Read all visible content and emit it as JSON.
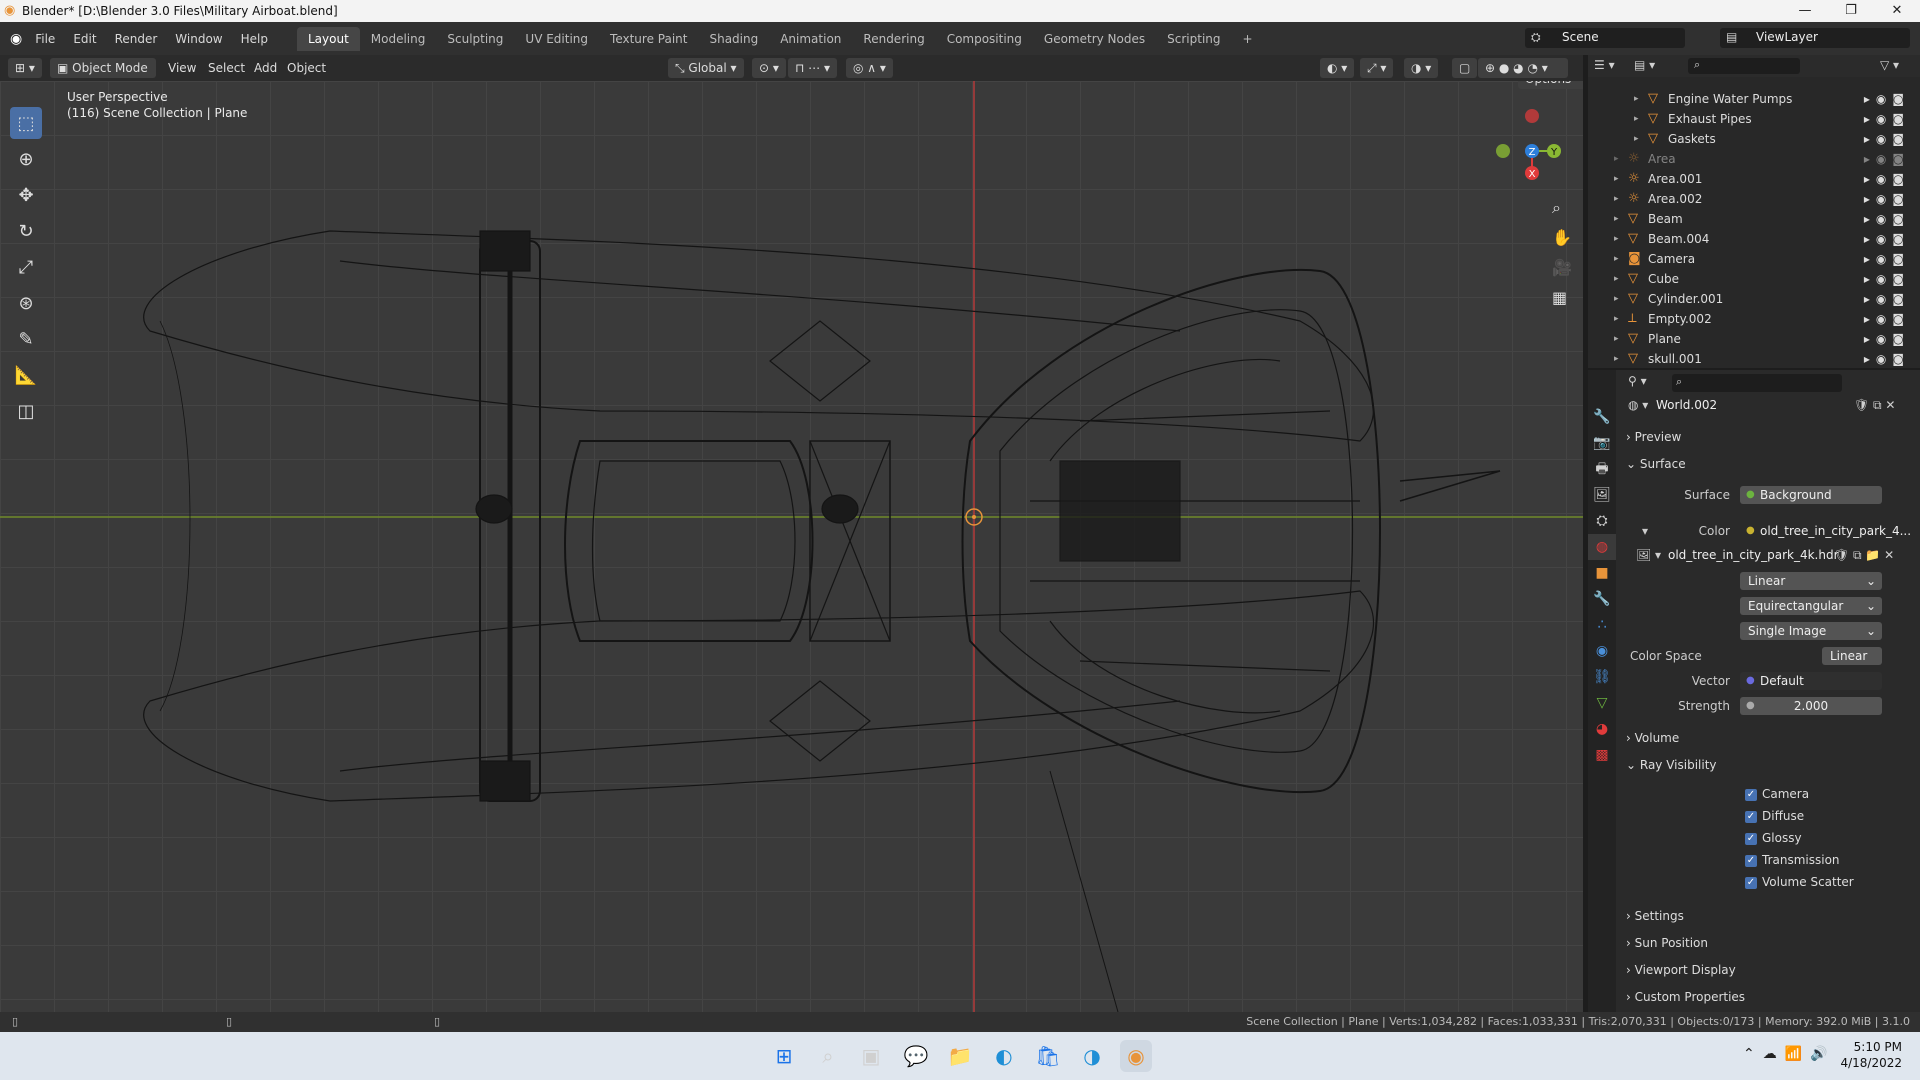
{
  "window": {
    "title": "Blender* [D:\\Blender 3.0 Files\\Military Airboat.blend]"
  },
  "menu": [
    "File",
    "Edit",
    "Render",
    "Window",
    "Help"
  ],
  "workspaces": [
    "Layout",
    "Modeling",
    "Sculpting",
    "UV Editing",
    "Texture Paint",
    "Shading",
    "Animation",
    "Rendering",
    "Compositing",
    "Geometry Nodes",
    "Scripting",
    "+"
  ],
  "active_workspace": "Layout",
  "scene": {
    "name": "Scene",
    "view_layer": "ViewLayer"
  },
  "viewport_header": {
    "mode": "Object Mode",
    "menus": [
      "View",
      "Select",
      "Add",
      "Object"
    ],
    "orientation": "Global",
    "options_label": "Options"
  },
  "viewport": {
    "perspective": "User Perspective",
    "collection_info": "(116) Scene Collection | Plane"
  },
  "outliner": {
    "items": [
      {
        "name": "Engine Water Pumps",
        "level": 2,
        "icon": "mesh-icon"
      },
      {
        "name": "Exhaust Pipes",
        "level": 2,
        "icon": "mesh-icon"
      },
      {
        "name": "Gaskets",
        "level": 2,
        "icon": "mesh-icon"
      },
      {
        "name": "Area",
        "level": 1,
        "icon": "light-icon",
        "dimmed": true
      },
      {
        "name": "Area.001",
        "level": 1,
        "icon": "light-icon"
      },
      {
        "name": "Area.002",
        "level": 1,
        "icon": "light-icon"
      },
      {
        "name": "Beam",
        "level": 1,
        "icon": "mesh-icon"
      },
      {
        "name": "Beam.004",
        "level": 1,
        "icon": "mesh-icon"
      },
      {
        "name": "Camera",
        "level": 1,
        "icon": "camera-icon"
      },
      {
        "name": "Cube",
        "level": 1,
        "icon": "mesh-icon"
      },
      {
        "name": "Cylinder.001",
        "level": 1,
        "icon": "mesh-icon"
      },
      {
        "name": "Empty.002",
        "level": 1,
        "icon": "empty-icon"
      },
      {
        "name": "Plane",
        "level": 1,
        "icon": "mesh-icon"
      },
      {
        "name": "skull.001",
        "level": 1,
        "icon": "mesh-icon"
      }
    ]
  },
  "properties": {
    "world_name": "World.002",
    "sections": {
      "preview": "Preview",
      "surface": "Surface",
      "volume": "Volume",
      "ray_visibility": "Ray Visibility",
      "settings": "Settings",
      "sun_position": "Sun Position",
      "viewport_display": "Viewport Display",
      "custom_properties": "Custom Properties"
    },
    "surface_label": "Surface",
    "surface_value": "Background",
    "color_label": "Color",
    "color_value": "old_tree_in_city_park_4...",
    "image_name": "old_tree_in_city_park_4k.hdr",
    "interpolation": "Linear",
    "projection": "Equirectangular",
    "source": "Single Image",
    "color_space_label": "Color Space",
    "color_space_value": "Linear",
    "vector_label": "Vector",
    "vector_value": "Default",
    "strength_label": "Strength",
    "strength_value": "2.000",
    "ray_checks": [
      "Camera",
      "Diffuse",
      "Glossy",
      "Transmission",
      "Volume Scatter"
    ]
  },
  "status": "Scene Collection | Plane | Verts:1,034,282 | Faces:1,033,331 | Tris:2,070,331 | Objects:0/173 | Memory: 392.0 MiB | 3.1.0",
  "taskbar": {
    "time": "5:10 PM",
    "date": "4/18/2022"
  },
  "colors": {
    "accent": "#4772b3",
    "object_orange": "#e8943a",
    "axis_x": "#e03b3b",
    "axis_y": "#8ab833",
    "axis_z": "#2d7fdb"
  }
}
